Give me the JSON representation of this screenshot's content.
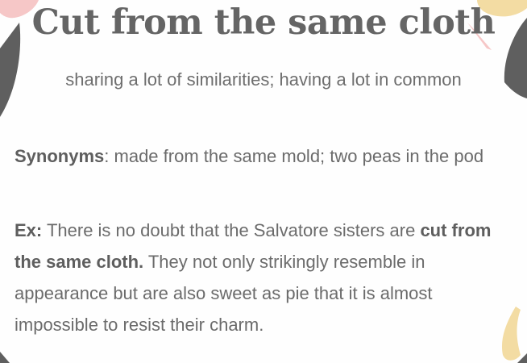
{
  "title": "Cut from the same cloth",
  "definition": "sharing a lot of similarities; having a lot in common",
  "synonyms": {
    "label": "Synonyms",
    "separator": ":",
    "text": " made from the same mold; two peas in the pod"
  },
  "example": {
    "label": "Ex:",
    "before": " There is no doubt that the Salvatore sisters are ",
    "phrase": "cut from the same cloth.",
    "after": " They not only strikingly resemble in appearance but are also sweet as pie that it is almost impossible to resist their charm."
  },
  "colors": {
    "dark_shape": "#5f5f5f",
    "pink_shape": "#f6c7c7",
    "gold_shape": "#f3dca3",
    "text": "#6b6b6b"
  }
}
